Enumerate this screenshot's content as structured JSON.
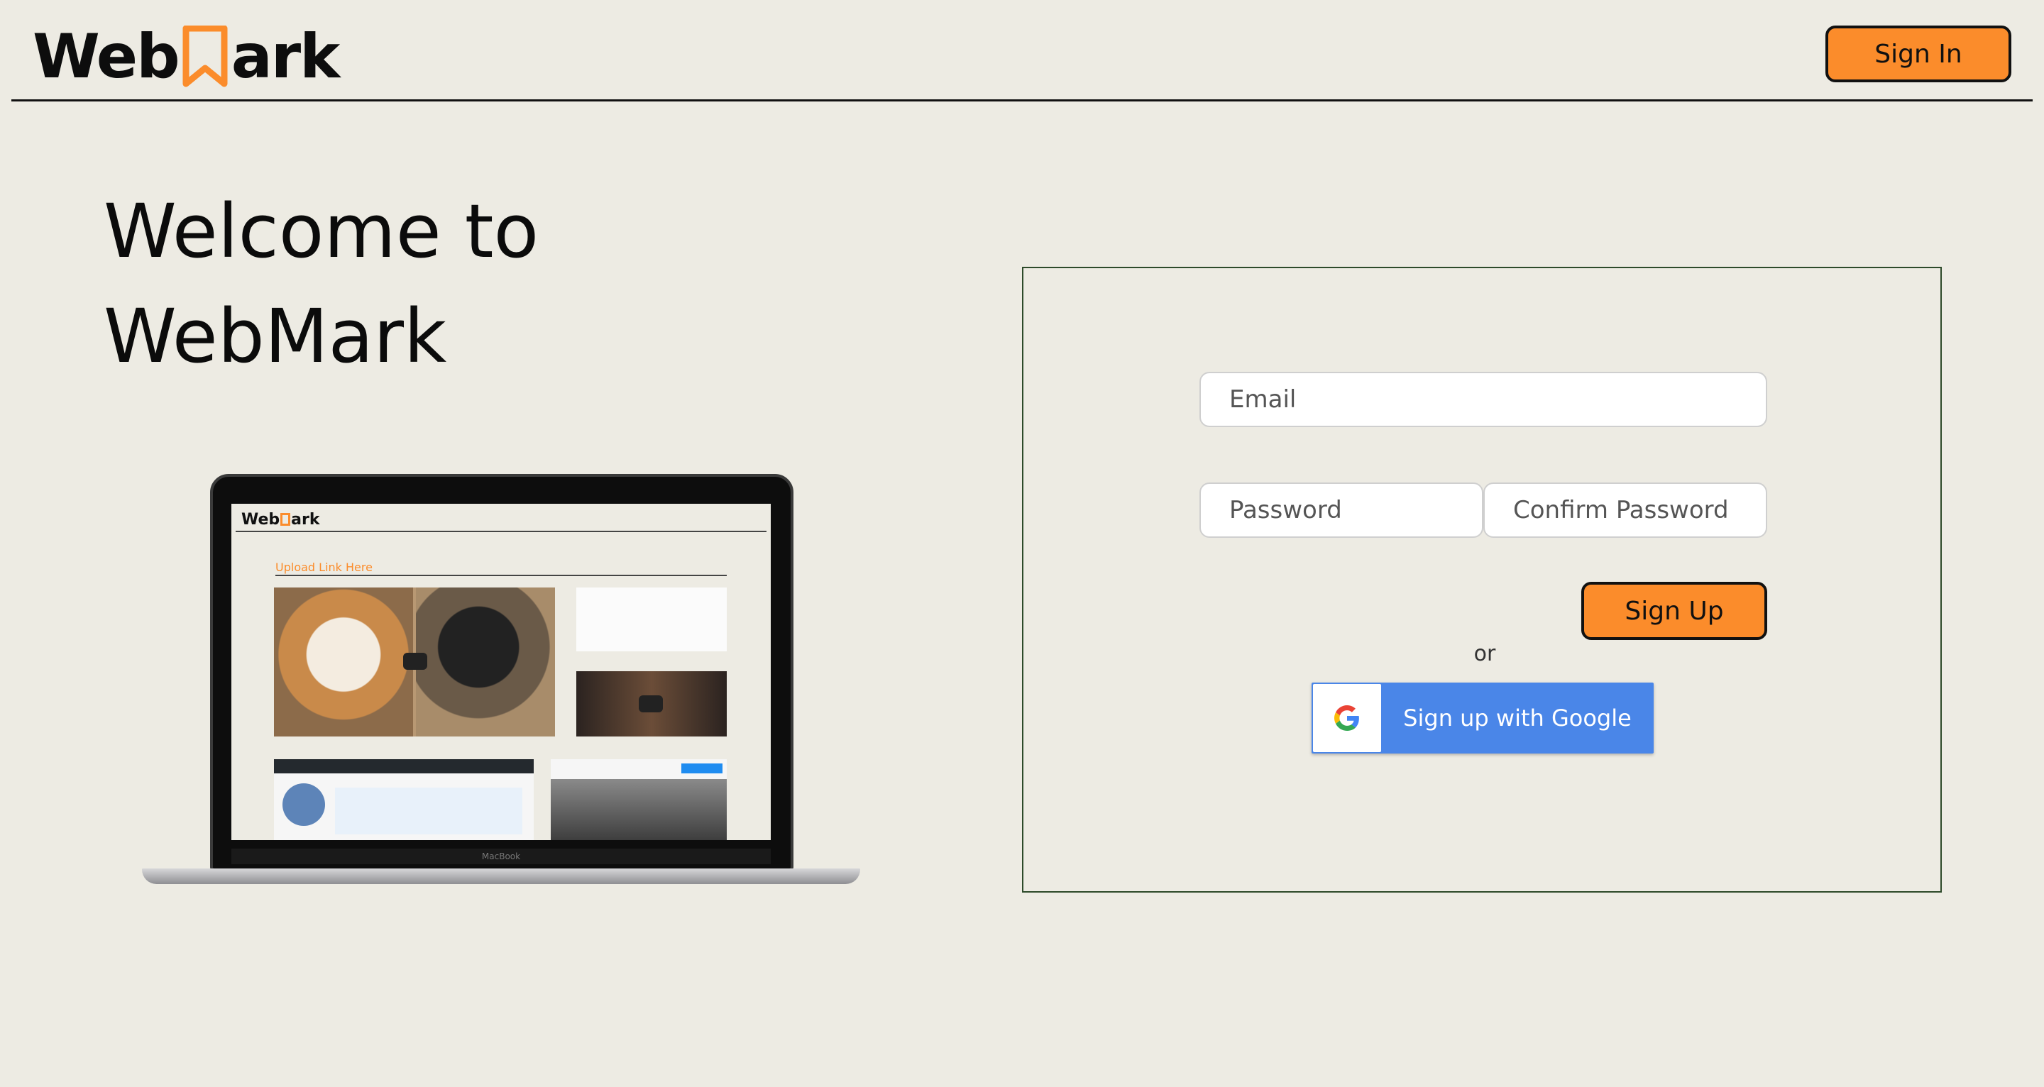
{
  "header": {
    "logo_prefix": "Web",
    "logo_suffix": "ark",
    "signin_label": "Sign In"
  },
  "welcome": {
    "line1": "Welcome to",
    "line2": "WebMark"
  },
  "laptop_preview": {
    "logo_prefix": "Web",
    "logo_suffix": "ark",
    "upload_label": "Upload Link Here",
    "hinge_label": "MacBook"
  },
  "form": {
    "email_placeholder": "Email",
    "password_placeholder": "Password",
    "confirm_placeholder": "Confirm Password",
    "signup_label": "Sign Up",
    "or_label": "or",
    "google_label": "Sign up with Google"
  },
  "colors": {
    "background": "#edebe3",
    "accent": "#fb8c2b",
    "google_blue": "#4a86e8",
    "card_border": "#2d4a2a"
  },
  "icons": [
    "bookmark-icon",
    "google-icon",
    "play-icon"
  ]
}
